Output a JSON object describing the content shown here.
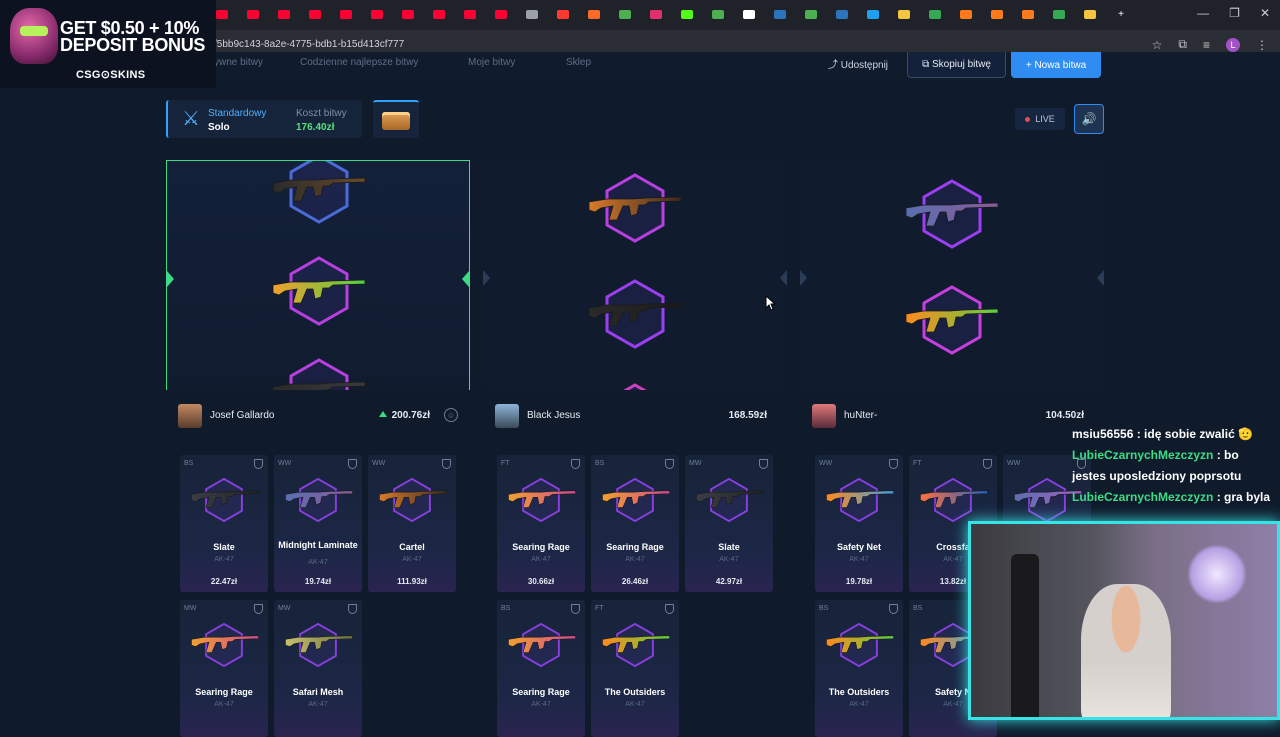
{
  "browser": {
    "url": "/5bb9c143-8a2e-4775-bdb1-b15d413cf777",
    "tab_icons": [
      "youtube",
      "youtube",
      "youtube",
      "youtube",
      "youtube",
      "youtube",
      "youtube",
      "youtube",
      "youtube",
      "youtube",
      "csgo",
      "app",
      "fire",
      "green",
      "instagram",
      "kick",
      "green",
      "x",
      "steam",
      "green",
      "steam",
      "blue",
      "yellow",
      "chrome",
      "orange",
      "orange",
      "orange",
      "chrome",
      "yellow"
    ],
    "new_tab": "+",
    "profile_initial": "L"
  },
  "promo": {
    "line1": "GET $0.50 + 10%",
    "line2": "DEPOSIT BONUS",
    "brand": "CSG⊙SKINS"
  },
  "nav": {
    "links": [
      "ywne bitwy",
      "Codzienne najlepsze bitwy",
      "Moje bitwy",
      "Sklep"
    ],
    "share": "Udostępnij",
    "copy": "Skopiuj bitwę",
    "new_battle": "+ Nowa bitwa"
  },
  "battle": {
    "mode_label": "Standardowy",
    "mode_value": "Solo",
    "cost_label": "Koszt bitwy",
    "cost_value": "176.40zł",
    "live": "LIVE"
  },
  "players": [
    {
      "name": "Josef Gallardo",
      "value": "200.76zł",
      "leading": true,
      "items": [
        {
          "wear": "BS",
          "name": "Slate",
          "sub": "AK-47",
          "price": "22.47zł"
        },
        {
          "wear": "WW",
          "name": "Midnight Laminate",
          "sub": "AK-47",
          "price": "19.74zł"
        },
        {
          "wear": "WW",
          "name": "Cartel",
          "sub": "AK-47",
          "price": "111.93zł"
        },
        {
          "wear": "MW",
          "name": "Searing Rage",
          "sub": "AK-47",
          "price": ""
        },
        {
          "wear": "MW",
          "name": "Safari Mesh",
          "sub": "AK-47",
          "price": ""
        }
      ]
    },
    {
      "name": "Black Jesus",
      "value": "168.59zł",
      "leading": false,
      "items": [
        {
          "wear": "FT",
          "name": "Searing Rage",
          "sub": "AK-47",
          "price": "30.66zł"
        },
        {
          "wear": "BS",
          "name": "Searing Rage",
          "sub": "AK-47",
          "price": "26.46zł"
        },
        {
          "wear": "MW",
          "name": "Slate",
          "sub": "AK-47",
          "price": "42.97zł"
        },
        {
          "wear": "BS",
          "name": "Searing Rage",
          "sub": "AK-47",
          "price": ""
        },
        {
          "wear": "FT",
          "name": "The Outsiders",
          "sub": "AK-47",
          "price": ""
        }
      ]
    },
    {
      "name": "huNter-",
      "value": "104.50zł",
      "leading": false,
      "items": [
        {
          "wear": "WW",
          "name": "Safety Net",
          "sub": "AK-47",
          "price": "19.78zł"
        },
        {
          "wear": "FT",
          "name": "Crossfa",
          "sub": "AK-47",
          "price": "13.82zł"
        },
        {
          "wear": "WW",
          "name": "",
          "sub": "",
          "price": ""
        },
        {
          "wear": "BS",
          "name": "The Outsiders",
          "sub": "AK-47",
          "price": ""
        },
        {
          "wear": "BS",
          "name": "Safety N",
          "sub": "AK-47",
          "price": ""
        }
      ]
    }
  ],
  "chat": [
    {
      "user": "msiu56556",
      "msg": " : idę sobie zwalić 🫡",
      "user_color": "white"
    },
    {
      "user": "LubieCzarnychMezczyzn",
      "msg": " : bo",
      "user_color": "green"
    },
    {
      "user": "",
      "msg": "jestes uposledziony poprsotu",
      "user_color": "green"
    },
    {
      "user": "LubieCzarnychMezczyzn",
      "msg": " : gra byla",
      "user_color": "green"
    }
  ],
  "colors": {
    "accent_blue": "#2f8cf2",
    "win_green": "#3ddc84",
    "hex_purple": "#9b3ff0",
    "hex_blue": "#4a6bd8",
    "webcam_border": "#38e3e6"
  }
}
